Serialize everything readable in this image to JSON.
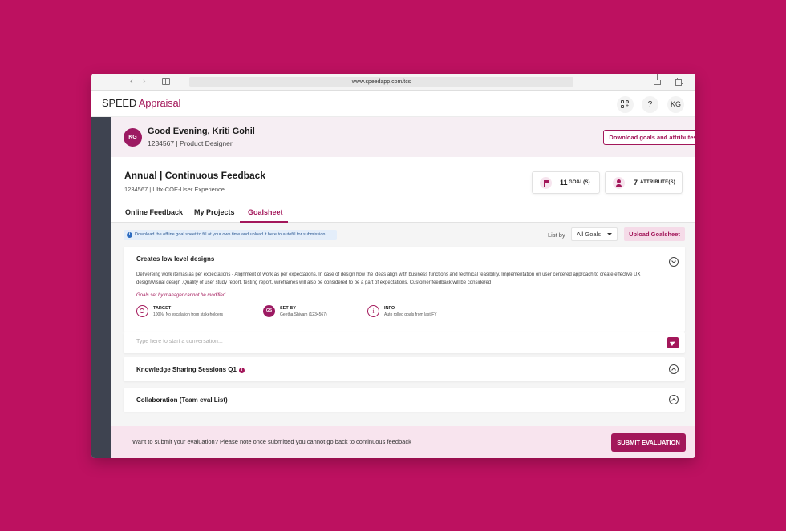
{
  "browser": {
    "url": "www.speedapp.com/tcs"
  },
  "app": {
    "brand_primary": "SPEED",
    "brand_secondary": "Appraisal",
    "help_label": "?",
    "user_initials": "KG",
    "accent_color": "#a3175a"
  },
  "greeting": {
    "avatar_initials": "KG",
    "title": "Good Evening, Kriti Gohil",
    "subtitle": "1234567 | Product Designer",
    "download_label": "Download goals and attributes"
  },
  "annual": {
    "title": "Annual | Continuous Feedback",
    "subtitle": "1234567 | Ultx-COE-User Experience",
    "goals_count": "11",
    "goals_label": "GOAL(S)",
    "attributes_count": "7",
    "attributes_label": "ATTRIBUTE(S)"
  },
  "tabs": [
    {
      "label": "Online Feedback",
      "active": false
    },
    {
      "label": "My Projects",
      "active": false
    },
    {
      "label": "Goalsheet",
      "active": true
    }
  ],
  "goalsheet": {
    "info_banner": "Download the offline goal sheet to fill at your own time and upload it here to autofill for submission",
    "list_by_label": "List by",
    "list_by_value": "All Goals",
    "upload_label": "Upload Goalsheet",
    "goals": [
      {
        "title": "Creates low level designs",
        "description": "Delivereing work itemas as per expectations - Alignment of work as per expectations. In case of design how the ideas align with business functions and technical feasibility. Implementation on user centered approach to create effective UX design/Visual design .Quality of user study report, testing report, wireframes will also be considered to be a part of expectations. Customer feedback will be considered",
        "warning": "Goals set by manager cannot be modified",
        "target_label": "TARGET",
        "target_value": "100%, No escalation from stakeholders",
        "setby_label": "SET BY",
        "setby_initials": "GS",
        "setby_value": "Geetha Shivam (1234567)",
        "info_label": "INFO",
        "info_value": "Auto rolled goals from last FY",
        "conversation_placeholder": "Type here to start a conversation..."
      },
      {
        "title": "Knowledge Sharing Sessions Q1"
      },
      {
        "title": "Collaboration (Team eval List)"
      }
    ]
  },
  "footer": {
    "message": "Want to submit your evaluation? Please note once submitted you cannot go back to continuous feedback",
    "submit_label": "SUBMIT EVALUATION"
  }
}
